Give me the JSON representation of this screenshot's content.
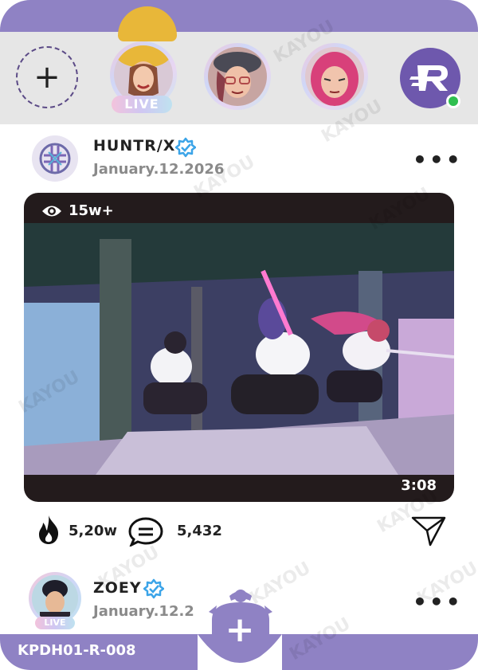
{
  "stories": {
    "add_label": "+",
    "live_label": "LIVE",
    "users": [
      "story-1",
      "story-2",
      "story-3"
    ]
  },
  "post1": {
    "user": "HUNTR/X",
    "date": "January.12.2026",
    "more": "•••",
    "views": "15w+",
    "duration": "3:08",
    "likes": "5,20w",
    "comments": "5,432"
  },
  "post2": {
    "user": "ZOEY",
    "date": "January.12.2",
    "live_label": "LIVE",
    "more": "•••"
  },
  "footer": {
    "card_code": "KPDH01-R-008",
    "fab_label": "+"
  },
  "watermark": "KAYOU",
  "colors": {
    "brand_purple": "#8f82c4",
    "logo_purple": "#6e58ad",
    "online_green": "#2fbf4f",
    "verified_blue": "#3ba4e8"
  }
}
